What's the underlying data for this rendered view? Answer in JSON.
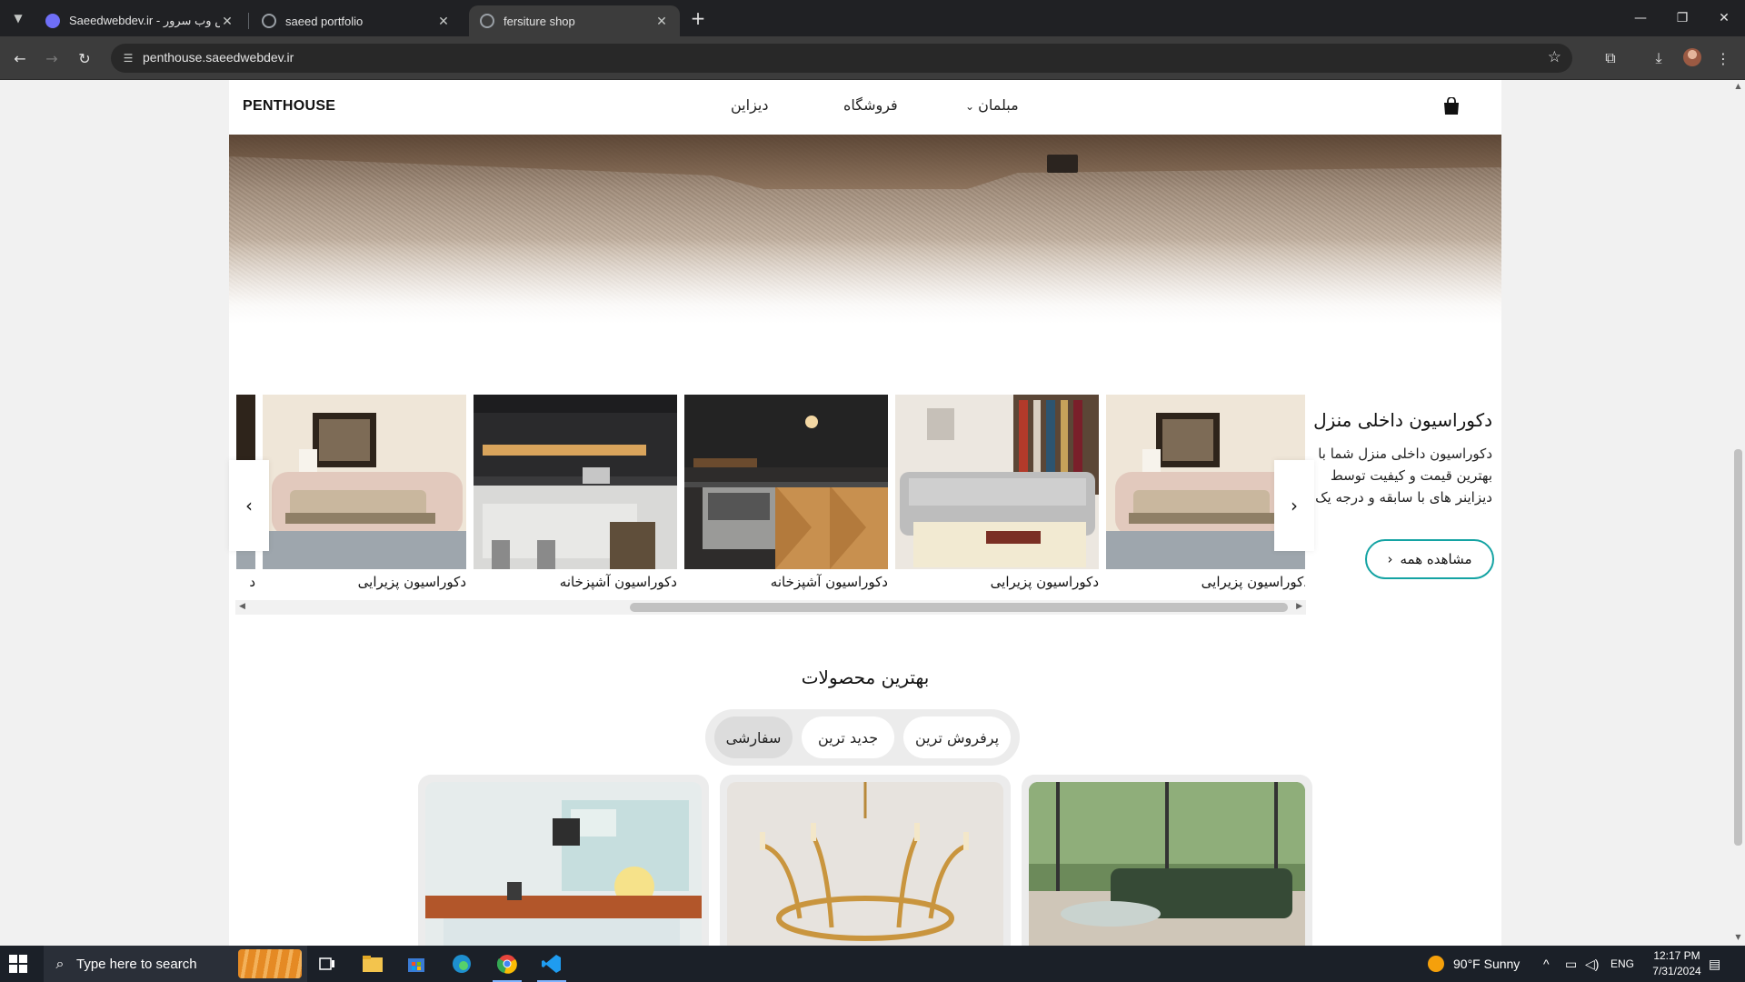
{
  "browser": {
    "tabs": [
      {
        "title": "Saeedwebdev.ir - پارس وب سرور",
        "active": false
      },
      {
        "title": "saeed portfolio",
        "active": false
      },
      {
        "title": "fersiture shop",
        "active": true
      }
    ],
    "url": "penthouse.saeedwebdev.ir"
  },
  "site": {
    "brand": "PENTHOUSE",
    "nav": {
      "designers": "دیزاین",
      "shop": "فروشگاه",
      "furniture": "مبلمان"
    },
    "decoration": {
      "title": "دکوراسیون داخلی منزل",
      "description": "دکوراسیون داخلی منزل شما با بهترین قیمت و کیفیت توسط دیزاینر های با سابقه و درجه یک",
      "see_all": "مشاهده همه",
      "cards": [
        {
          "caption": "دکوراسیون پزیرایی",
          "scene": "living-room"
        },
        {
          "caption": "دکوراسیون پزیرایی",
          "scene": "grey-sofa"
        },
        {
          "caption": "دکوراسیون آشپزخانه",
          "scene": "kitchen-wood"
        },
        {
          "caption": "دکوراسیون آشپزخانه",
          "scene": "kitchen-dark"
        },
        {
          "caption": "دکوراسیون پزیرایی",
          "scene": "living-room"
        },
        {
          "caption": "د",
          "scene": "living-room"
        }
      ]
    },
    "best_products": {
      "title": "بهترین محصولات",
      "filters": [
        {
          "label": "پرفروش ترین",
          "active": false
        },
        {
          "label": "جدید ترین",
          "active": false
        },
        {
          "label": "سفارشی",
          "active": true
        }
      ],
      "products": [
        {
          "scene": "green-sofa"
        },
        {
          "scene": "chandelier"
        },
        {
          "scene": "desk"
        }
      ]
    }
  },
  "taskbar": {
    "search_placeholder": "Type here to search",
    "weather": "90°F  Sunny",
    "language": "ENG",
    "time": "12:17 PM",
    "date": "7/31/2024"
  }
}
